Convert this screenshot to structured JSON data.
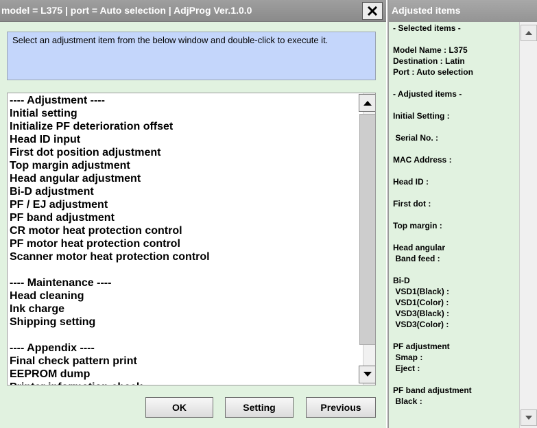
{
  "main_window": {
    "title": "model = L375 | port = Auto selection | AdjProg Ver.1.0.0",
    "instruction": "Select an adjustment item from the below window and double-click to execute it.",
    "list_items": [
      "---- Adjustment ----",
      "Initial setting",
      "Initialize PF deterioration offset",
      "Head ID input",
      "First dot position adjustment",
      "Top margin adjustment",
      "Head angular adjustment",
      "Bi-D adjustment",
      "PF / EJ adjustment",
      "PF band adjustment",
      "CR motor heat protection control",
      "PF motor heat protection control",
      "Scanner motor heat protection control",
      "",
      "---- Maintenance ----",
      "Head cleaning",
      "Ink charge",
      "Shipping setting",
      "",
      "---- Appendix ----",
      "Final check pattern print",
      "EEPROM dump",
      "Printer information check"
    ],
    "buttons": {
      "ok": "OK",
      "setting": "Setting",
      "previous": "Previous"
    }
  },
  "side_window": {
    "title": "Adjusted items",
    "lines": [
      "- Selected items -",
      "",
      "Model Name : L375",
      "Destination : Latin",
      "Port : Auto selection",
      "",
      "- Adjusted items -",
      "",
      "Initial Setting :",
      "",
      " Serial No. :",
      "",
      "MAC Address :",
      "",
      "Head ID :",
      "",
      "First dot :",
      "",
      "Top margin :",
      "",
      "Head angular",
      " Band feed :",
      "",
      "Bi-D",
      " VSD1(Black) :",
      " VSD1(Color) :",
      " VSD3(Black) :",
      " VSD3(Color) :",
      "",
      "PF adjustment",
      " Smap :",
      " Eject :",
      "",
      "PF band adjustment",
      " Black :"
    ]
  },
  "icons": {
    "close": "close-icon",
    "scroll_up": "triangle-up-icon",
    "scroll_down": "triangle-down-icon"
  }
}
